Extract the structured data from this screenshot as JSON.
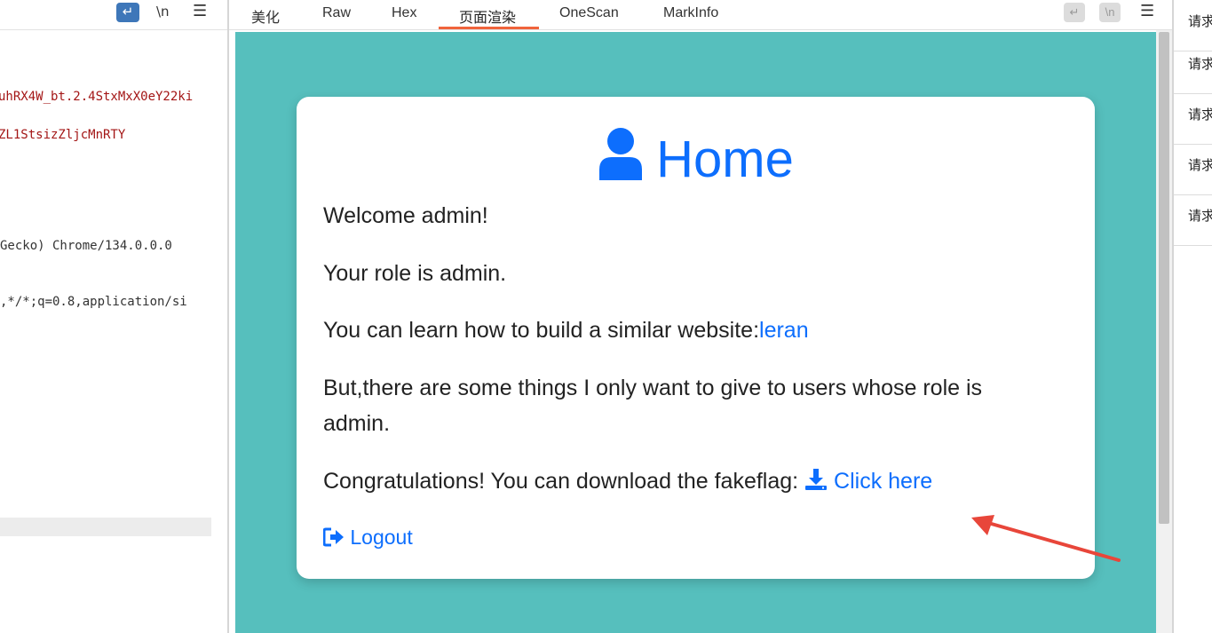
{
  "left_pane": {
    "toolbar": {
      "wrap_icon": "↵",
      "newline_label": "\\n",
      "menu_icon": "☰"
    },
    "lines": [
      "uhRX4W_bt.2.4StxMxX0eY22ki",
      "ZL1StsizZljcMnRTY",
      "Gecko) Chrome/134.0.0.0",
      ",*/*;q=0.8,application/si"
    ]
  },
  "tabs": [
    "美化",
    "Raw",
    "Hex",
    "页面渲染",
    "OneScan",
    "MarkInfo"
  ],
  "active_tab": "页面渲染",
  "toolbar_right": {
    "wrap_icon": "↵",
    "newline_label": "\\n",
    "menu_icon": "☰"
  },
  "page": {
    "title": "Home",
    "welcome": "Welcome admin!",
    "role": "Your role is admin.",
    "learn_prefix": "You can learn how to build a similar website:",
    "learn_link": "leran",
    "admin_line1": "But,there are some things I only want to give to users whose role is",
    "admin_line2": "admin.",
    "congrats_prefix": "Congratulations! You can download the fakeflag: ",
    "download_link": "Click here",
    "logout": "Logout",
    "accent_color": "#0d6efd",
    "background_color": "#56bfbd"
  },
  "right_pane": {
    "items": [
      "请求",
      "请求",
      "请求",
      "请求",
      "请求"
    ]
  }
}
